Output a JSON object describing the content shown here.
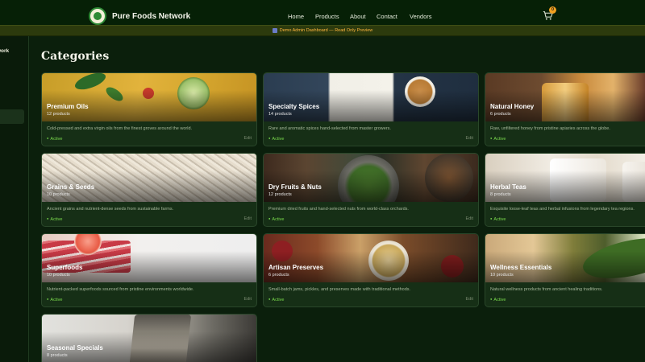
{
  "header": {
    "brand_name": "Pure Foods Network",
    "nav": [
      "Home",
      "Products",
      "About",
      "Contact",
      "Vendors"
    ],
    "cart_count": "0"
  },
  "banner": {
    "text": "Demo Admin Dashboard — Read Only Preview"
  },
  "sidebar": {
    "brand_fragment": "work"
  },
  "main": {
    "title": "Categories"
  },
  "categories": [
    {
      "name": "Premium Oils",
      "count": "12 products",
      "description": "Cold-pressed and extra virgin oils from the finest groves around the world.",
      "status": "Active",
      "edit": "Edit"
    },
    {
      "name": "Specialty Spices",
      "count": "14 products",
      "description": "Rare and aromatic spices hand-selected from master growers.",
      "status": "Active",
      "edit": "Edit"
    },
    {
      "name": "Natural Honey",
      "count": "6 products",
      "description": "Raw, unfiltered honey from pristine apiaries across the globe.",
      "status": "Active",
      "edit": "Edit"
    },
    {
      "name": "Grains & Seeds",
      "count": "10 products",
      "description": "Ancient grains and nutrient-dense seeds from sustainable farms.",
      "status": "Active",
      "edit": "Edit"
    },
    {
      "name": "Dry Fruits & Nuts",
      "count": "12 products",
      "description": "Premium dried fruits and hand-selected nuts from world-class orchards.",
      "status": "Active",
      "edit": "Edit"
    },
    {
      "name": "Herbal Teas",
      "count": "8 products",
      "description": "Exquisite loose-leaf teas and herbal infusions from legendary tea regions.",
      "status": "Active",
      "edit": "Edit"
    },
    {
      "name": "Superfoods",
      "count": "10 products",
      "description": "Nutrient-packed superfoods sourced from pristine environments worldwide.",
      "status": "Active",
      "edit": "Edit"
    },
    {
      "name": "Artisan Preserves",
      "count": "6 products",
      "description": "Small-batch jams, pickles, and preserves made with traditional methods.",
      "status": "Active",
      "edit": "Edit"
    },
    {
      "name": "Wellness Essentials",
      "count": "10 products",
      "description": "Natural wellness products from ancient healing traditions.",
      "status": "Active",
      "edit": "Edit"
    },
    {
      "name": "Seasonal Specials",
      "count": "8 products",
      "description": "",
      "status": "",
      "edit": ""
    }
  ],
  "colors": {
    "background": "#0b1f0c",
    "card": "#162f16",
    "accent_active": "#7bdc4d",
    "banner_text": "#ffb640",
    "cart_badge": "#f0a020"
  },
  "icons": {
    "logo": "globe-leaf-logo",
    "cart": "shopping-cart-icon",
    "banner": "chart-icon"
  }
}
